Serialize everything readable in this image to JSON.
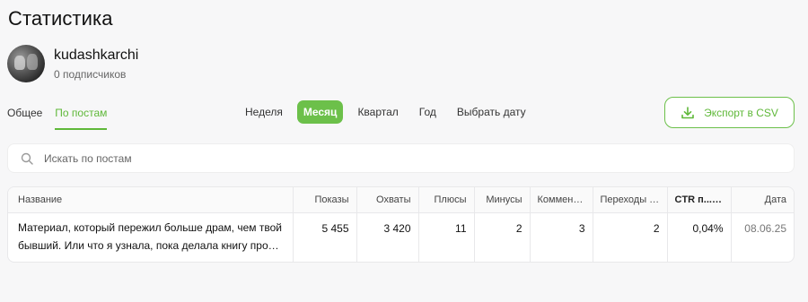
{
  "header": {
    "title": "Статистика"
  },
  "profile": {
    "username": "kudashkarchi",
    "subscribers": "0 подписчиков"
  },
  "tabs": [
    {
      "label": "Общее",
      "active": false
    },
    {
      "label": "По постам",
      "active": true
    }
  ],
  "periods": [
    {
      "label": "Неделя",
      "active": false
    },
    {
      "label": "Месяц",
      "active": true
    },
    {
      "label": "Квартал",
      "active": false
    },
    {
      "label": "Год",
      "active": false
    },
    {
      "label": "Выбрать дату",
      "active": false
    }
  ],
  "export": {
    "label": "Экспорт в CSV",
    "icon": "download-icon"
  },
  "search": {
    "placeholder": "Искать по постам",
    "value": "",
    "icon": "search-icon"
  },
  "table": {
    "columns": [
      "Название",
      "Показы",
      "Охваты",
      "Плюсы",
      "Минусы",
      "Комментарии",
      "Переходы по ссылкам",
      "CTR п...",
      "Дата"
    ],
    "rows": [
      {
        "title": "Материал, который пережил больше драм, чем твой бывший. Или что я узнала, пока делала книгу про котов",
        "views": "5 455",
        "reach": "3 420",
        "pluses": "11",
        "minuses": "2",
        "comments": "3",
        "clicks": "2",
        "ctr": "0,04%",
        "date": "08.06.25"
      }
    ]
  },
  "colors": {
    "accent": "#6cc04a",
    "accent_text": "#5fb839",
    "background": "#f7f7f8"
  }
}
